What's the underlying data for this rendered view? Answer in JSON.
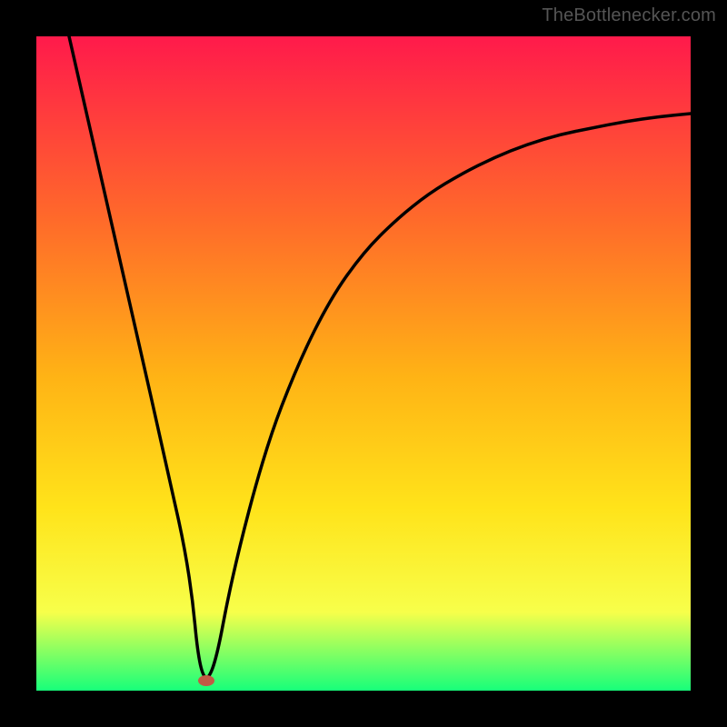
{
  "attribution": "TheBottlenecker.com",
  "chart_data": {
    "type": "line",
    "title": "",
    "xlabel": "",
    "ylabel": "",
    "xlim": [
      0,
      100
    ],
    "ylim": [
      0,
      100
    ],
    "gradient_colors": {
      "top": "#ff1a4b",
      "upper_mid": "#ff6a2a",
      "mid": "#ffb315",
      "lower_mid": "#ffe31a",
      "lower": "#f7ff4a",
      "bottom": "#17ff7a"
    },
    "series": [
      {
        "name": "bottleneck-curve",
        "x": [
          5,
          10,
          15,
          20,
          23.5,
          25,
          27,
          30,
          35,
          40,
          45,
          50,
          55,
          60,
          65,
          70,
          75,
          80,
          85,
          90,
          95,
          100
        ],
        "values": [
          100,
          78,
          56,
          34,
          18,
          2,
          2,
          18,
          37,
          50,
          60,
          67,
          72,
          76,
          79,
          81.5,
          83.5,
          85,
          86,
          87,
          87.7,
          88.2
        ]
      }
    ],
    "annotations": [
      {
        "name": "minimum-marker",
        "x": 26,
        "y": 1.5,
        "color": "#c15a45"
      }
    ]
  }
}
